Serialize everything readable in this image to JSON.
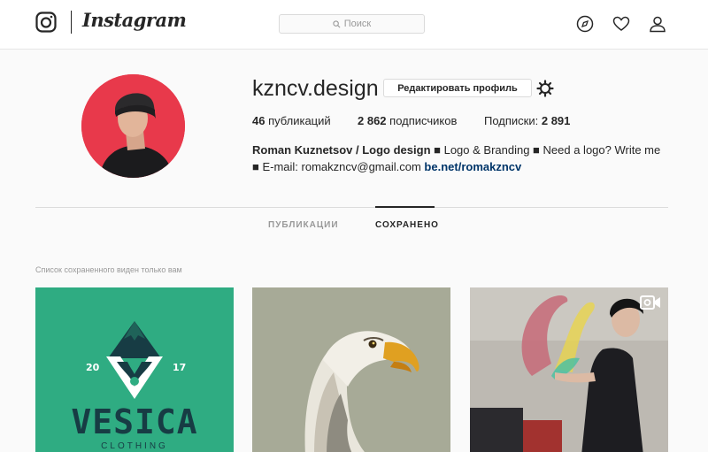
{
  "header": {
    "wordmark": "Instagram",
    "search_placeholder": "Поиск",
    "icons": [
      "instagram-camera-icon",
      "search-icon",
      "explore-icon",
      "heart-icon",
      "profile-icon"
    ]
  },
  "profile": {
    "username": "kzncv.design",
    "edit_label": "Редактировать профиль",
    "stats": {
      "posts_count": "46",
      "posts_label": " публикаций",
      "followers_count": "2 862",
      "followers_label": " подписчиков",
      "following_label": "Подписки: ",
      "following_count": "2 891"
    },
    "bio": {
      "name": "Roman Kuznetsov / Logo design",
      "text": " ■ Logo & Branding ■ Need a logo? Write me ■ E-mail: romakzncv@gmail.com ",
      "link": "be.net/romakzncv"
    }
  },
  "tabs": [
    {
      "label": "ПУБЛИКАЦИИ",
      "active": false
    },
    {
      "label": "СОХРАНЕНО",
      "active": true
    }
  ],
  "saved_note": "Список сохраненного виден только вам",
  "grid": {
    "tile1": {
      "year_left": "20",
      "year_right": "17",
      "title": "VESICA",
      "subtitle": "CLOTHING",
      "bg": "#2fac82"
    },
    "tile2": {
      "bg": "#a7aa97"
    },
    "tile3": {
      "bg": "#bdb9b2",
      "media_icon": "video-icon"
    }
  }
}
